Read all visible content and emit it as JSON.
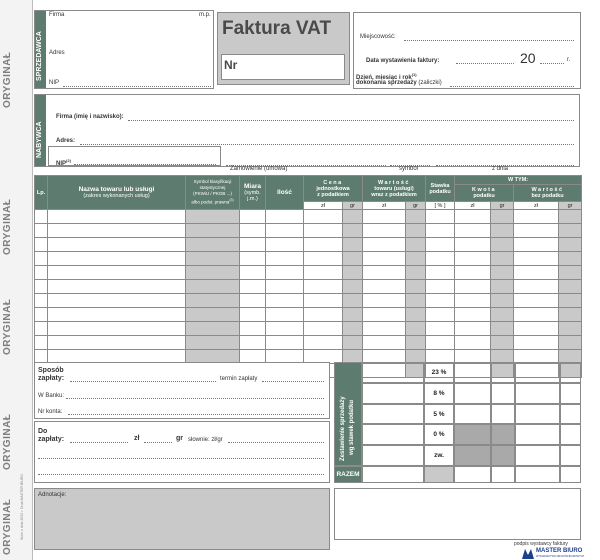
{
  "side": {
    "original_label": "ORYGINAŁ",
    "small_print": "Wzór z dnia 2022 r. Druk MASTER BIURO"
  },
  "seller": {
    "section_label": "SPRZEDAWCA",
    "firm_label": "Firma",
    "mp_label": "m.p.",
    "address_label": "Adres",
    "nip_label": "NIP"
  },
  "header": {
    "title": "Faktura VAT",
    "nr_label": "Nr",
    "place_label": "Miejscowość:",
    "issue_date_label": "Data wystawienia faktury:",
    "year_prefix": "20",
    "year_suffix": "r.",
    "sale_date_label_1": "Dzień, miesiąc i rok",
    "sale_date_sup": "(1)",
    "sale_date_label_2": "dokonania sprzedaży",
    "sale_date_label_3": "(zaliczki)"
  },
  "buyer": {
    "section_label": "NABYWCA",
    "firm_label": "Firma (imię i nazwisko):",
    "address_label": "Adres:",
    "nip_label": "NIP",
    "nip_sup": "(2)"
  },
  "order": {
    "order_label": "Zamówienie (umowa)",
    "symbol_label": "symbol",
    "date_label": "z dnia"
  },
  "table": {
    "col_lp": "Lp.",
    "col_name_1": "Nazwa towaru lub usługi",
    "col_name_2": "(zakres wykonanych usług)",
    "col_symbol_1": "Symbol klasyfikacji",
    "col_symbol_2": "statystycznej",
    "col_symbol_3": "(PKWiU / PKOB ...)",
    "col_symbol_4": "albo podst. prawna",
    "col_symbol_sup": "(3)",
    "col_unit_1": "Miara",
    "col_unit_2": "(symb.",
    "col_unit_3": "j.m.)",
    "col_qty": "Ilość",
    "col_price_1": "Cena",
    "col_price_2": "jednostkowa",
    "col_price_3": "z podatkiem",
    "col_value_1": "Wartość",
    "col_value_2": "towaru (usługi)",
    "col_value_3": "wraz z podatkiem",
    "col_rate_1": "Stawka",
    "col_rate_2": "podatku",
    "col_wtym": "W TYM:",
    "col_tax_1": "Kwota",
    "col_tax_2": "podatku",
    "col_net_1": "Wartość",
    "col_net_2": "bez podatku",
    "zl": "zł",
    "gr": "gr",
    "pct": "[ % ]",
    "row_count": 12
  },
  "payment": {
    "method_label_1": "Sposób",
    "method_label_2": "zapłaty:",
    "due_label": "termin zapłaty",
    "bank_label": "W Banku:",
    "account_label": "Nr konta:",
    "pay_label_1": "Do",
    "pay_label_2": "zapłaty:",
    "zl": "zł",
    "gr": "gr",
    "words_label": "słownie: zł/gr"
  },
  "summary": {
    "vertical_label_1": "Zestawienie sprzedaży",
    "vertical_label_2": "wg stawek podatku",
    "rates": [
      "23 %",
      "8 %",
      "5 %",
      "0 %",
      "zw."
    ],
    "total_label": "RAZEM"
  },
  "notes": {
    "label": "Adnotacje:",
    "signature_label": "podpis wystawcy faktury"
  },
  "brand": {
    "name": "MASTER BIURO",
    "tagline": "WYDAWNICTWO DRUKÓW BIUROWYCH"
  },
  "colors": {
    "accent": "#5d7b6e",
    "shade": "#c9c9c9"
  }
}
